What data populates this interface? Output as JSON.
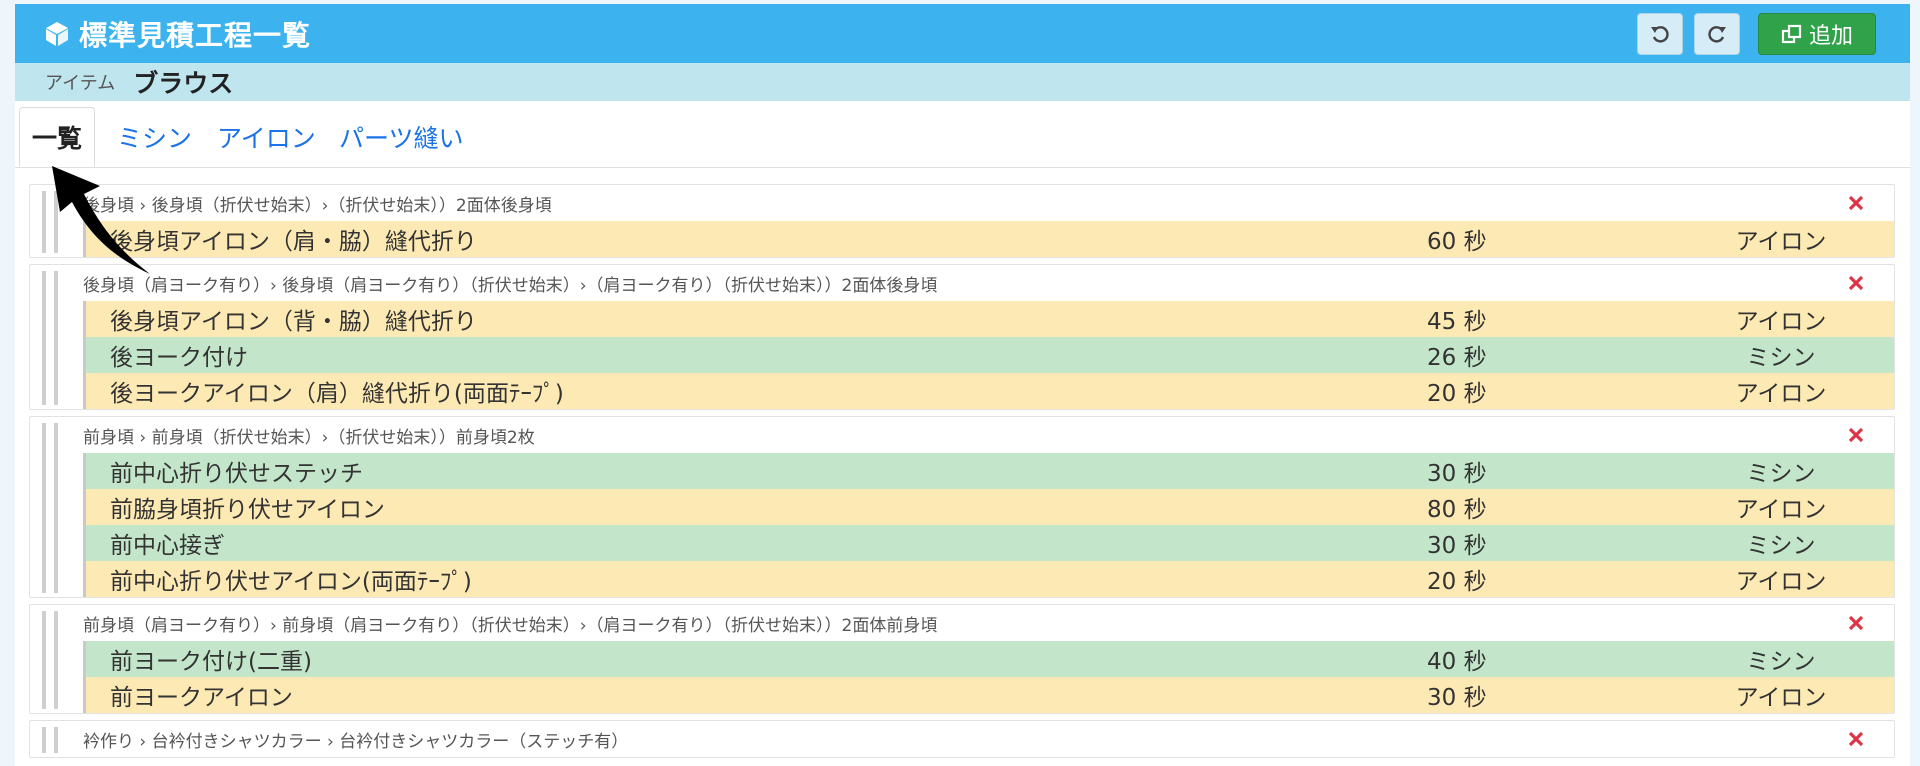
{
  "header": {
    "title": "標準見積工程一覧",
    "add_label": "追加"
  },
  "item": {
    "label": "アイテム",
    "value": "ブラウス"
  },
  "tabs": [
    "一覧",
    "ミシン",
    "アイロン",
    "パーツ縫い"
  ],
  "groups": [
    {
      "path": "後身頃 › 後身頃（折伏せ始末）›（折伏せ始末））2面体後身頃",
      "rows": [
        {
          "name": "後身頃アイロン（肩・脇）縫代折り",
          "sec": "60 秒",
          "kind": "アイロン",
          "type": "iron"
        }
      ]
    },
    {
      "path": "後身頃（肩ヨーク有り）› 後身頃（肩ヨーク有り）（折伏せ始末）›（肩ヨーク有り）（折伏せ始末））2面体後身頃",
      "rows": [
        {
          "name": "後身頃アイロン（背・脇）縫代折り",
          "sec": "45 秒",
          "kind": "アイロン",
          "type": "iron"
        },
        {
          "name": "後ヨーク付け",
          "sec": "26 秒",
          "kind": "ミシン",
          "type": "sew"
        },
        {
          "name": "後ヨークアイロン（肩）縫代折り(両面ﾃｰﾌﾟ)",
          "sec": "20 秒",
          "kind": "アイロン",
          "type": "iron"
        }
      ]
    },
    {
      "path": "前身頃 › 前身頃（折伏せ始末）›（折伏せ始末））前身頃2枚",
      "rows": [
        {
          "name": "前中心折り伏せステッチ",
          "sec": "30 秒",
          "kind": "ミシン",
          "type": "sew"
        },
        {
          "name": "前脇身頃折り伏せアイロン",
          "sec": "80 秒",
          "kind": "アイロン",
          "type": "iron"
        },
        {
          "name": "前中心接ぎ",
          "sec": "30 秒",
          "kind": "ミシン",
          "type": "sew"
        },
        {
          "name": "前中心折り伏せアイロン(両面ﾃｰﾌﾟ)",
          "sec": "20 秒",
          "kind": "アイロン",
          "type": "iron"
        }
      ]
    },
    {
      "path": "前身頃（肩ヨーク有り）› 前身頃（肩ヨーク有り）（折伏せ始末）›（肩ヨーク有り）（折伏せ始末））2面体前身頃",
      "rows": [
        {
          "name": "前ヨーク付け(二重)",
          "sec": "40 秒",
          "kind": "ミシン",
          "type": "sew"
        },
        {
          "name": "前ヨークアイロン",
          "sec": "30 秒",
          "kind": "アイロン",
          "type": "iron"
        }
      ]
    },
    {
      "path": "衿作り › 台衿付きシャツカラー › 台衿付きシャツカラー（ステッチ有）",
      "rows": []
    }
  ],
  "colors": {
    "header": "#3cb3ee",
    "itembar": "#bfe6ef",
    "iron": "#fde9b3",
    "sew": "#c3e6cb",
    "add": "#2fa24a",
    "delete": "#dc3545"
  },
  "icons": {
    "title": "cube-icon",
    "undo": "undo-icon",
    "redo": "redo-icon",
    "add": "window-plus-icon",
    "delete": "close-icon"
  }
}
